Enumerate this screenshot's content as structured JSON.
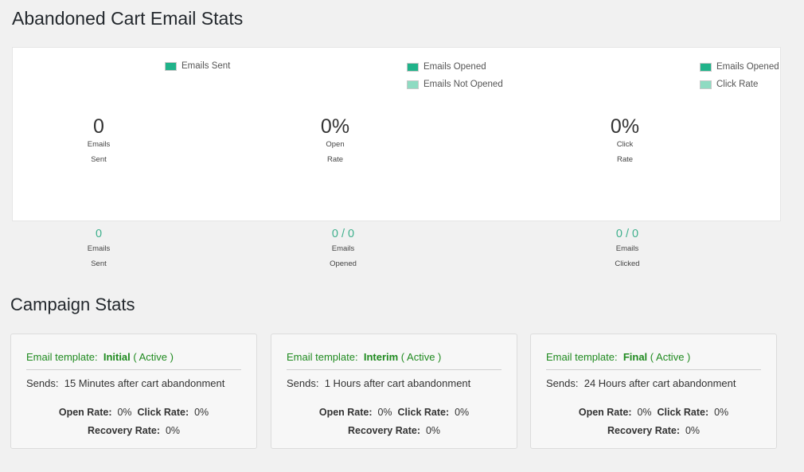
{
  "page": {
    "title": "Abandoned Cart Email Stats",
    "campaign_title": "Campaign Stats"
  },
  "charts": [
    {
      "legend": [
        {
          "label": "Emails Sent",
          "color": "#20b38a"
        }
      ],
      "value": "0",
      "label1": "Emails",
      "label2": "Sent",
      "summary_value": "0",
      "summary_label1": "Emails",
      "summary_label2": "Sent"
    },
    {
      "legend": [
        {
          "label": "Emails Opened",
          "color": "#20b38a"
        },
        {
          "label": "Emails Not Opened",
          "color": "#8fdbc2"
        }
      ],
      "value": "0%",
      "label1": "Open",
      "label2": "Rate",
      "summary_value": "0 / 0",
      "summary_label1": "Emails",
      "summary_label2": "Opened"
    },
    {
      "legend": [
        {
          "label": "Emails Opened",
          "color": "#20b38a"
        },
        {
          "label": "Click Rate",
          "color": "#8fdbc2"
        }
      ],
      "value": "0%",
      "label1": "Click",
      "label2": "Rate",
      "summary_value": "0 / 0",
      "summary_label1": "Emails",
      "summary_label2": "Clicked"
    }
  ],
  "campaigns": [
    {
      "tpl_label": "Email template:",
      "name": "Initial",
      "status": "( Active )",
      "sends_label": "Sends:",
      "sends": "15 Minutes after cart abandonment",
      "open_label": "Open Rate:",
      "open": "0%",
      "click_label": "Click Rate:",
      "click": "0%",
      "recovery_label": "Recovery Rate:",
      "recovery": "0%"
    },
    {
      "tpl_label": "Email template:",
      "name": "Interim",
      "status": "( Active )",
      "sends_label": "Sends:",
      "sends": "1 Hours after cart abandonment",
      "open_label": "Open Rate:",
      "open": "0%",
      "click_label": "Click Rate:",
      "click": "0%",
      "recovery_label": "Recovery Rate:",
      "recovery": "0%"
    },
    {
      "tpl_label": "Email template:",
      "name": "Final",
      "status": "( Active )",
      "sends_label": "Sends:",
      "sends": "24 Hours after cart abandonment",
      "open_label": "Open Rate:",
      "open": "0%",
      "click_label": "Click Rate:",
      "click": "0%",
      "recovery_label": "Recovery Rate:",
      "recovery": "0%"
    }
  ]
}
